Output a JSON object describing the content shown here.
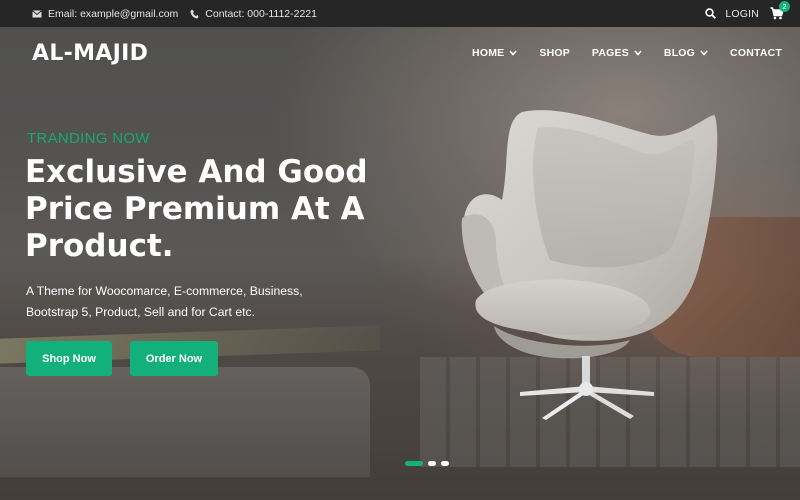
{
  "topbar": {
    "email": "Email: example@gmail.com",
    "contact": "Contact: 000-1112-2221",
    "login": "LOGIN",
    "cart_count": "2"
  },
  "brand": {
    "logo": "AL-MAJID"
  },
  "nav": {
    "items": [
      {
        "label": "HOME",
        "has_dropdown": true
      },
      {
        "label": "SHOP",
        "has_dropdown": false
      },
      {
        "label": "PAGES",
        "has_dropdown": true
      },
      {
        "label": "BLOG",
        "has_dropdown": true
      },
      {
        "label": "CONTACT",
        "has_dropdown": false
      }
    ]
  },
  "hero": {
    "eyebrow": "TRANDING NOW",
    "headline": "Exclusive And Good Price Premium At A Product.",
    "subtext": "A Theme for Woocomarce, E-commerce, Business, Bootstrap 5, Product, Sell and for Cart etc.",
    "primary_button": "Shop Now",
    "secondary_button": "Order Now"
  },
  "slider": {
    "slides": 3,
    "active": 1
  },
  "colors": {
    "accent": "#14b07b",
    "topbar": "#262626"
  },
  "icons": [
    "email-icon",
    "phone-icon",
    "search-icon",
    "cart-icon",
    "chevron-down-icon"
  ]
}
